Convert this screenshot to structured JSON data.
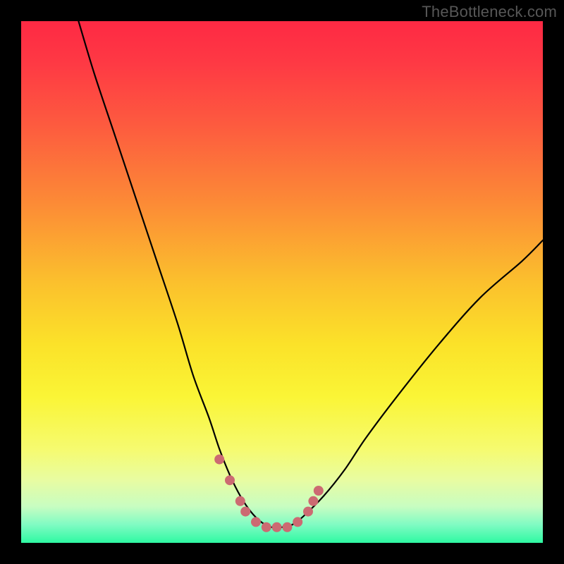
{
  "watermark": "TheBottleneck.com",
  "colors": {
    "black": "#000000",
    "gradient_stops": [
      {
        "offset": 0.0,
        "color": "#fe2944"
      },
      {
        "offset": 0.08,
        "color": "#fe3944"
      },
      {
        "offset": 0.2,
        "color": "#fd5b3f"
      },
      {
        "offset": 0.35,
        "color": "#fc8b36"
      },
      {
        "offset": 0.5,
        "color": "#fbc02d"
      },
      {
        "offset": 0.62,
        "color": "#fbe229"
      },
      {
        "offset": 0.72,
        "color": "#faf536"
      },
      {
        "offset": 0.82,
        "color": "#f6fb6f"
      },
      {
        "offset": 0.88,
        "color": "#e8fca2"
      },
      {
        "offset": 0.93,
        "color": "#c8fdc1"
      },
      {
        "offset": 0.965,
        "color": "#80fbc3"
      },
      {
        "offset": 1.0,
        "color": "#2ef9a2"
      }
    ],
    "curve": "#000000",
    "marker_fill": "#cc6a72",
    "marker_stroke": "#b85a62"
  },
  "chart_data": {
    "type": "line",
    "title": "",
    "xlabel": "",
    "ylabel": "",
    "xlim": [
      0,
      100
    ],
    "ylim": [
      0,
      100
    ],
    "series": [
      {
        "name": "bottleneck-curve",
        "x": [
          11,
          14,
          18,
          22,
          26,
          30,
          33,
          36,
          38,
          40,
          42,
          44,
          46,
          48,
          50,
          52,
          54,
          58,
          62,
          66,
          72,
          80,
          88,
          96,
          100
        ],
        "y": [
          100,
          90,
          78,
          66,
          54,
          42,
          32,
          24,
          18,
          13,
          9,
          6,
          4,
          3,
          3,
          3.5,
          5,
          9,
          14,
          20,
          28,
          38,
          47,
          54,
          58
        ]
      }
    ],
    "markers": {
      "name": "highlight-points",
      "x": [
        38,
        40,
        42,
        43,
        45,
        47,
        49,
        51,
        53,
        55,
        56,
        57
      ],
      "y": [
        16,
        12,
        8,
        6,
        4,
        3,
        3,
        3,
        4,
        6,
        8,
        10
      ]
    }
  }
}
